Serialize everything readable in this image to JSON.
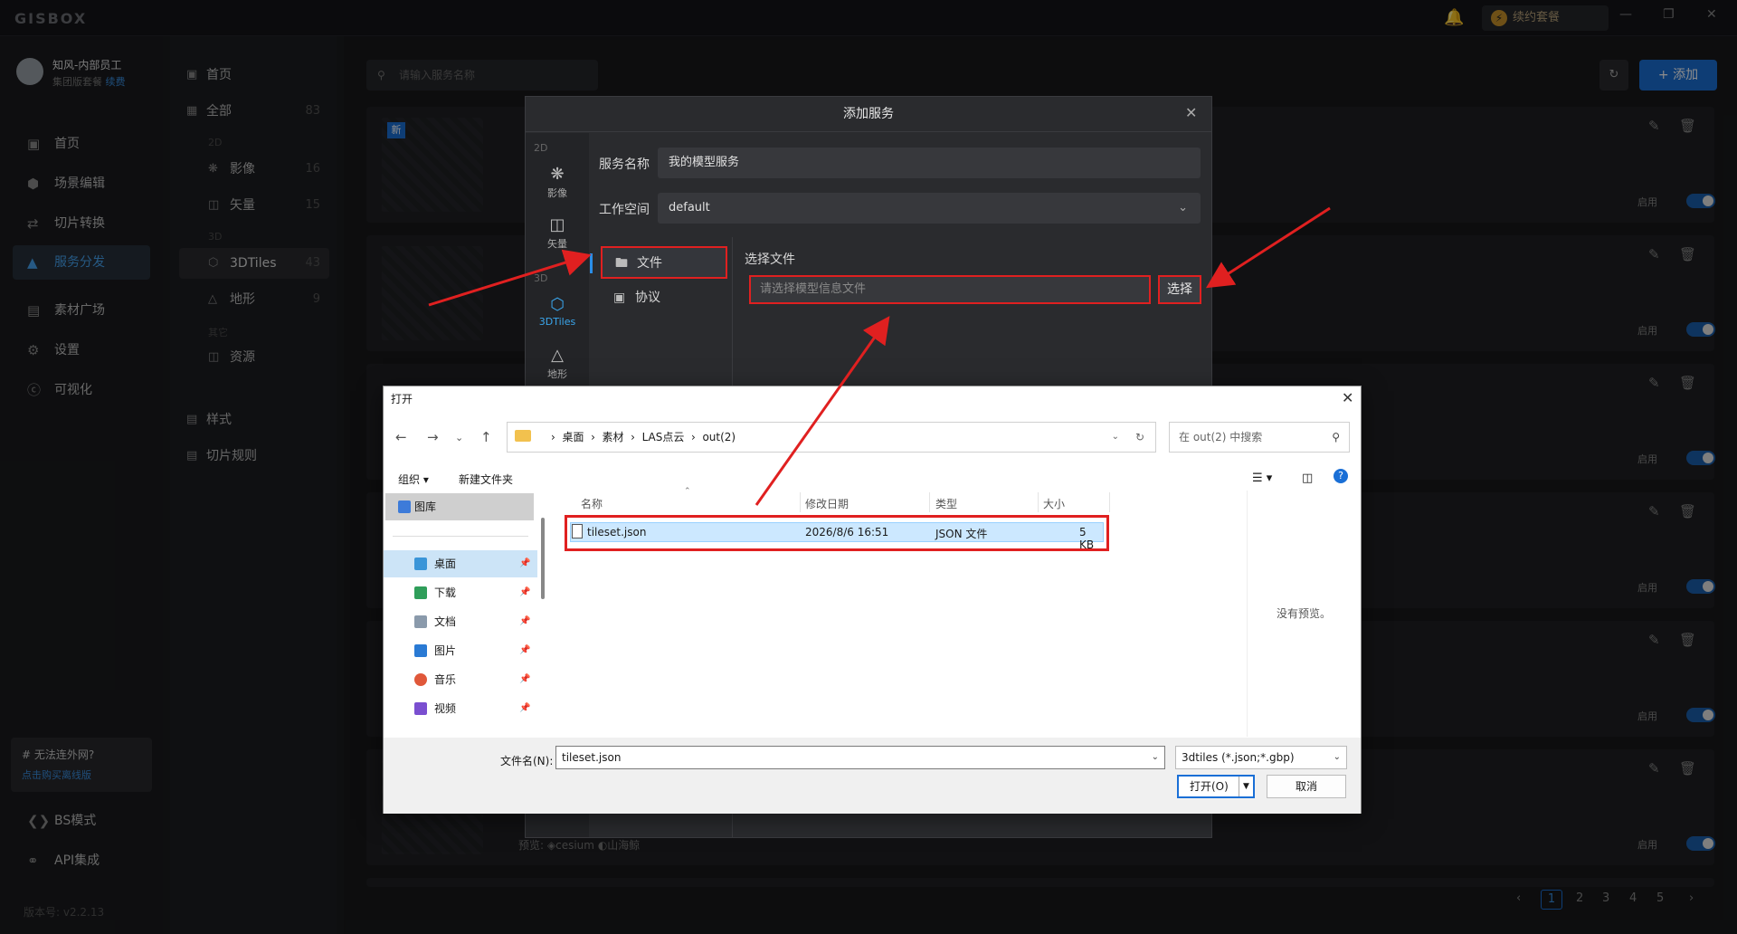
{
  "app": {
    "logo": "GISBOX",
    "renew_label": "续约套餐"
  },
  "user": {
    "name": "知风-内部员工",
    "plan": "集团版套餐",
    "renew_link": "续费"
  },
  "nav": {
    "items": [
      {
        "label": "首页",
        "icon": "home-icon"
      },
      {
        "label": "场景编辑",
        "icon": "cube-icon"
      },
      {
        "label": "切片转换",
        "icon": "convert-icon"
      },
      {
        "label": "服务分发",
        "icon": "upload-icon",
        "active": true
      },
      {
        "label": "素材广场",
        "icon": "image-icon"
      },
      {
        "label": "设置",
        "icon": "gear-icon"
      },
      {
        "label": "可视化",
        "icon": "chart-icon"
      }
    ],
    "promo_title": "# 无法连外网?",
    "promo_link": "点击购买离线版",
    "bs_mode": "BS模式",
    "api": "API集成",
    "version": "版本号: v2.2.13"
  },
  "subnav": {
    "home": "首页",
    "all": "全部",
    "all_count": "83",
    "group_2d": "2D",
    "imagery": "影像",
    "imagery_count": "16",
    "vector": "矢量",
    "vector_count": "15",
    "group_3d": "3D",
    "tiles": "3DTiles",
    "tiles_count": "43",
    "terrain": "地形",
    "terrain_count": "9",
    "group_other": "其它",
    "resource": "资源",
    "style": "样式",
    "tile_rules": "切片规则"
  },
  "main": {
    "search_placeholder": "请输入服务名称",
    "add_label": "添加",
    "new_badge": "新",
    "enable_label": "启用",
    "preview_label": "预览:",
    "preview_cesium": "cesium",
    "preview_shanhai": "山海鲸",
    "pages": [
      "1",
      "2",
      "3",
      "4",
      "5"
    ]
  },
  "dialog": {
    "title": "添加服务",
    "tabs": {
      "sec_2d": "2D",
      "imagery": "影像",
      "vector": "矢量",
      "sec_3d": "3D",
      "tiles": "3DTiles",
      "terrain": "地形"
    },
    "service_name_label": "服务名称",
    "service_name_value": "我的模型服务",
    "workspace_label": "工作空间",
    "workspace_value": "default",
    "source_file": "文件",
    "source_protocol": "协议",
    "choose_file_label": "选择文件",
    "file_placeholder": "请选择模型信息文件",
    "choose_button": "选择"
  },
  "file_dialog": {
    "title": "打开",
    "breadcrumb": [
      "桌面",
      "素材",
      "LAS点云",
      "out(2)"
    ],
    "search_placeholder": "在 out(2) 中搜索",
    "organize": "组织",
    "new_folder": "新建文件夹",
    "sidebar": [
      {
        "label": "图库",
        "icon": "gallery-icon"
      },
      {
        "label": "桌面",
        "icon": "desktop-icon",
        "pinned": true
      },
      {
        "label": "下载",
        "icon": "download-icon",
        "pinned": true
      },
      {
        "label": "文档",
        "icon": "document-icon",
        "pinned": true
      },
      {
        "label": "图片",
        "icon": "picture-icon",
        "pinned": true
      },
      {
        "label": "音乐",
        "icon": "music-icon",
        "pinned": true
      },
      {
        "label": "视频",
        "icon": "video-icon",
        "pinned": true
      }
    ],
    "columns": [
      "名称",
      "修改日期",
      "类型",
      "大小"
    ],
    "files": [
      {
        "name": "tileset.json",
        "modified": "2026/8/6 16:51",
        "type": "JSON 文件",
        "size": "5 KB"
      }
    ],
    "no_preview": "没有预览。",
    "filename_label": "文件名(N):",
    "filename_value": "tileset.json",
    "filter_value": "3dtiles (*.json;*.gbp)",
    "open_button": "打开(O)",
    "cancel_button": "取消"
  },
  "colors": {
    "accent": "#1a6fd6",
    "highlight_red": "#e02020"
  }
}
